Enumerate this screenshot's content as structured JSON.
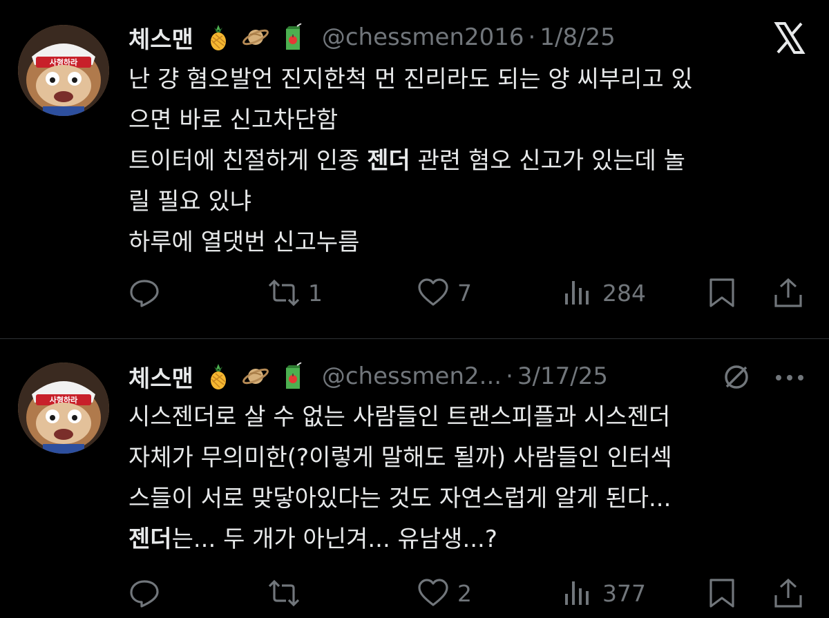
{
  "tweets": [
    {
      "author_name": "체스맨",
      "handle": "@chessmen2016",
      "separator": "·",
      "date": "1/8/25",
      "avatar_badge": "사형하라",
      "header_emojis": [
        "pineapple",
        "ringed-planet",
        "juice-box"
      ],
      "top_right_icon": "x-logo-icon",
      "lines": [
        [
          {
            "text": "난 걍 혐오발언 진지한척 먼 진리라도 되는 양 씨부리고 있",
            "bold": false
          }
        ],
        [
          {
            "text": "으면 바로 신고차단함",
            "bold": false
          }
        ],
        [
          {
            "text": "트이터에 친절하게 인종 ",
            "bold": false
          },
          {
            "text": "젠더",
            "bold": true
          },
          {
            "text": " 관련 혐오 신고가 있는데 놀",
            "bold": false
          }
        ],
        [
          {
            "text": "릴 필요 있냐",
            "bold": false
          }
        ],
        [
          {
            "text": "하루에 열댓번 신고누름",
            "bold": false
          }
        ]
      ],
      "actions": {
        "reply": "",
        "retweet": "1",
        "like": "7",
        "views": "284"
      }
    },
    {
      "author_name": "체스맨",
      "handle": "@chessmen2...",
      "separator": "·",
      "date": "3/17/25",
      "avatar_badge": "사형하라",
      "header_emojis": [
        "pineapple",
        "ringed-planet",
        "juice-box"
      ],
      "top_right_icons": [
        "slash-circle-icon",
        "more-dots-icon"
      ],
      "lines": [
        [
          {
            "text": "시스젠더로 살 수 없는 사람들인 트랜스피플과 시스젠더",
            "bold": false
          }
        ],
        [
          {
            "text": "자체가 무의미한(?이렇게 말해도 될까) 사람들인 인터섹",
            "bold": false
          }
        ],
        [
          {
            "text": "스들이 서로 맞닿아있다는 것도 자연스럽게 알게 된다...",
            "bold": false
          }
        ],
        [
          {
            "text": "젠더",
            "bold": true
          },
          {
            "text": "는... 두 개가 아닌겨... 유남생...?",
            "bold": false
          }
        ]
      ],
      "actions": {
        "reply": "",
        "retweet": "",
        "like": "2",
        "views": "377"
      }
    }
  ],
  "colors": {
    "background": "#000000",
    "text": "#e7e9ea",
    "muted": "#71767b",
    "divider": "#2f3336"
  }
}
